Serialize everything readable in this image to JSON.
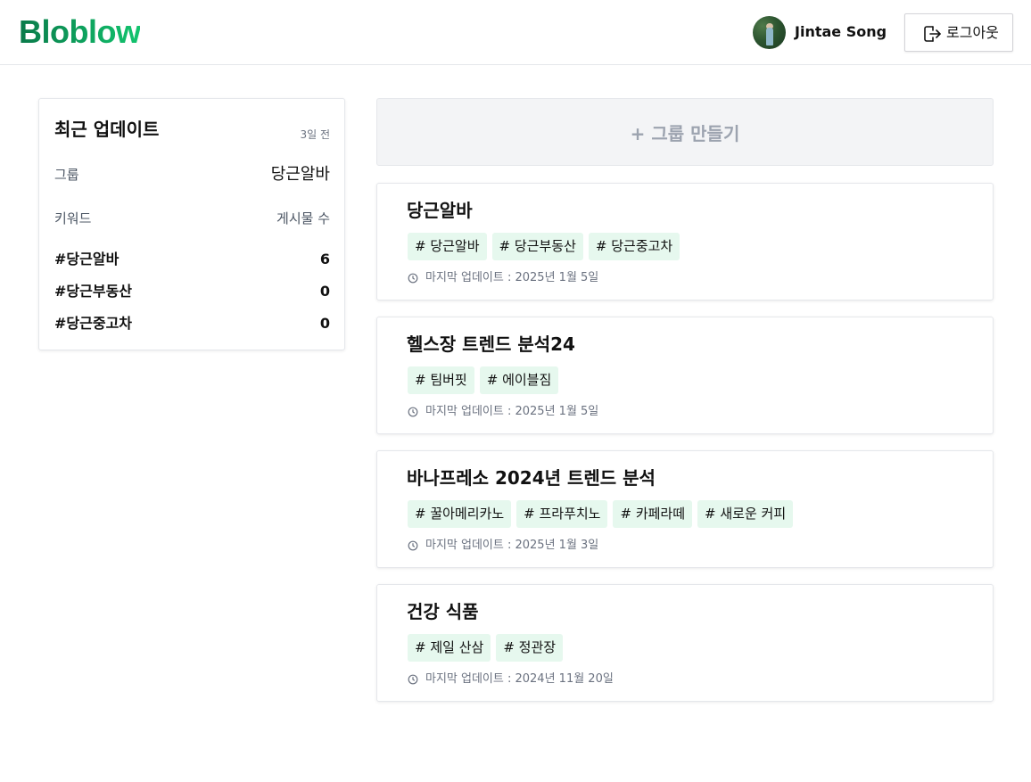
{
  "header": {
    "logo": "Bloblow",
    "user_name": "Jintae Song",
    "logout_label": "로그아웃"
  },
  "recent": {
    "title": "최근 업데이트",
    "time_ago": "3일 전",
    "group_label": "그룹",
    "group_value": "당근알바",
    "keyword_label": "키워드",
    "post_count_label": "게시물 수",
    "keywords": [
      {
        "name": "#당근알바",
        "count": "6"
      },
      {
        "name": "#당근부동산",
        "count": "0"
      },
      {
        "name": "#당근중고차",
        "count": "0"
      }
    ]
  },
  "create_group_label": "+ 그룹 만들기",
  "groups": [
    {
      "title": "당근알바",
      "tags": [
        "# 당근알바",
        "# 당근부동산",
        "# 당근중고차"
      ],
      "updated": "마지막 업데이트 : 2025년 1월 5일"
    },
    {
      "title": "헬스장 트렌드 분석24",
      "tags": [
        "# 팀버핏",
        "# 에이블짐"
      ],
      "updated": "마지막 업데이트 : 2025년 1월 5일"
    },
    {
      "title": "바나프레소 2024년 트렌드 분석",
      "tags": [
        "# 꿀아메리카노",
        "# 프라푸치노",
        "# 카페라떼",
        "# 새로운 커피"
      ],
      "updated": "마지막 업데이트 : 2025년 1월 3일"
    },
    {
      "title": "건강 식품",
      "tags": [
        "# 제일 산삼",
        "# 정관장"
      ],
      "updated": "마지막 업데이트 : 2024년 11월 20일"
    }
  ],
  "colors": {
    "brand_start": "#0a7a4a",
    "brand_end": "#12c46e",
    "tag_bg": "#e6f8ee",
    "create_bg": "#f3f4f6"
  }
}
